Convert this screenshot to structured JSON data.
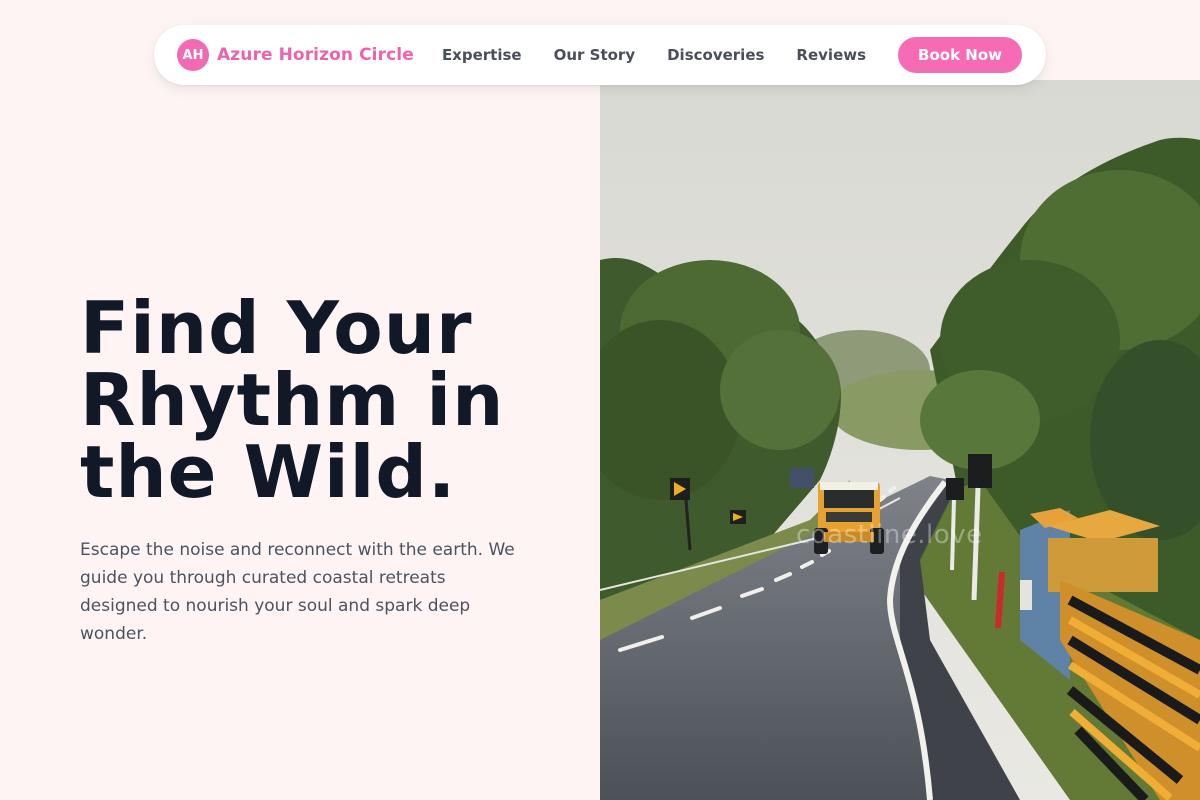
{
  "brand": {
    "initials": "AH",
    "name": "Azure Horizon Circle"
  },
  "nav": {
    "links": [
      "Expertise",
      "Our Story",
      "Discoveries",
      "Reviews"
    ],
    "cta": "Book Now"
  },
  "hero": {
    "title_lines": [
      "Find Your",
      "Rhythm in",
      "the Wild."
    ],
    "description": "Escape the noise and reconnect with the earth. We guide you through curated coastal retreats designed to nourish your soul and spark deep wonder.",
    "image_watermark": "coastline.love"
  },
  "colors": {
    "page_background": "#fff4f4",
    "accent_pink": "#f56bb4",
    "heading_text": "#111827",
    "body_text": "#4b5260"
  }
}
